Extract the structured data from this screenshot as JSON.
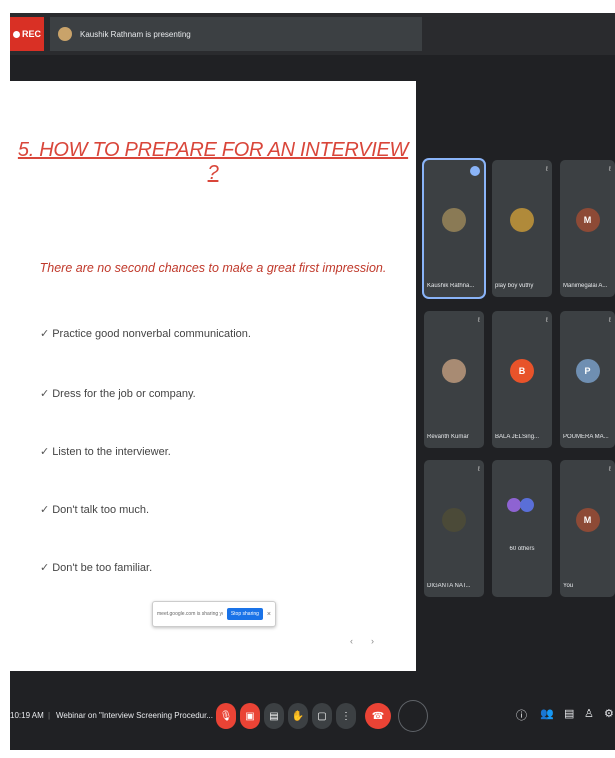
{
  "topbar": {
    "rec_label": "REC",
    "presenting_text": "Kaushik Rathnam is presenting"
  },
  "slide": {
    "title": "5. HOW TO PREPARE FOR AN INTERVIEW ?",
    "subtitle": "There are no second chances to make a great first impression.",
    "bullets": [
      "Practice good nonverbal communication.",
      "Dress for the job or company.",
      "Listen to the interviewer.",
      "Don't talk too much.",
      "Don't be too familiar."
    ],
    "share_bar": {
      "label": "meet.google.com is sharing your screen.",
      "button": "Stop sharing"
    }
  },
  "participants": [
    {
      "name": "Kaushik Rathna...",
      "initial": "",
      "avatar_color": "#8a7a55",
      "active": true
    },
    {
      "name": "play boy vuthy",
      "initial": "",
      "avatar_color": "#b08a3a",
      "active": false
    },
    {
      "name": "Manimegalai A...",
      "initial": "M",
      "avatar_color": "#8d4a36",
      "active": false
    },
    {
      "name": "Revanth Kumar",
      "initial": "",
      "avatar_color": "#a88b73",
      "active": false
    },
    {
      "name": "BALA JELSing...",
      "initial": "B",
      "avatar_color": "#e8532a",
      "active": false
    },
    {
      "name": "POUMERA MA...",
      "initial": "P",
      "avatar_color": "#6f8fb2",
      "active": false
    },
    {
      "name": "DIGANTA NAT...",
      "initial": "",
      "avatar_color": "#4b4a38",
      "active": false
    },
    {
      "name": "60 others",
      "initial": "",
      "avatar_color": "#8e63d2",
      "active": false
    },
    {
      "name": "You",
      "initial": "M",
      "avatar_color": "#8d4a36",
      "active": false
    }
  ],
  "bottombar": {
    "time": "10:19 AM",
    "meeting_title": "Webinar on \"Interview Screening Procedur..."
  },
  "colors": {
    "meet_bg": "#202124",
    "tile_bg": "#3c4043",
    "red": "#ea4335",
    "title_red": "#d9463a",
    "accent_blue": "#8ab4f8"
  }
}
